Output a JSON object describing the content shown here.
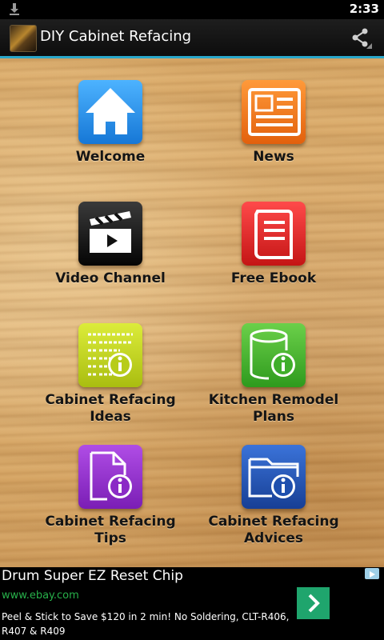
{
  "status_bar": {
    "time": "2:33",
    "download_icon": "download-icon"
  },
  "action_bar": {
    "title": "DIY Cabinet Refacing",
    "share_icon": "share-icon"
  },
  "menu": {
    "items": [
      {
        "label": "Welcome",
        "icon": "home-icon",
        "color": "#1f8fe0"
      },
      {
        "label": "News",
        "icon": "newspaper-icon",
        "color": "#ee6b12"
      },
      {
        "label": "Video Channel",
        "icon": "clapperboard-icon",
        "color": "#1a1a1a"
      },
      {
        "label": "Free Ebook",
        "icon": "book-icon",
        "color": "#d92020"
      },
      {
        "label": "Cabinet Refacing Ideas",
        "line1": "Cabinet Refacing",
        "line2": "Ideas",
        "icon": "list-info-icon",
        "color": "#b7cc19"
      },
      {
        "label": "Kitchen Remodel Plans",
        "line1": "Kitchen Remodel",
        "line2": "Plans",
        "icon": "database-info-icon",
        "color": "#3fae2a"
      },
      {
        "label": "Cabinet Refacing Tips",
        "line1": "Cabinet Refacing",
        "line2": "Tips",
        "icon": "document-info-icon",
        "color": "#8b2bc6"
      },
      {
        "label": "Cabinet Refacing Advices",
        "line1": "Cabinet Refacing",
        "line2": "Advices",
        "icon": "folder-info-icon",
        "color": "#1e4fae"
      }
    ]
  },
  "ad": {
    "title": "Drum Super EZ Reset Chip",
    "url": "www.ebay.com",
    "text": "Peel & Stick to Save $120 in 2 min! No Soldering, CLT-R406, R407 & R409",
    "go_icon": "chevron-right-icon",
    "adchoices_icon": "adchoices-icon"
  }
}
